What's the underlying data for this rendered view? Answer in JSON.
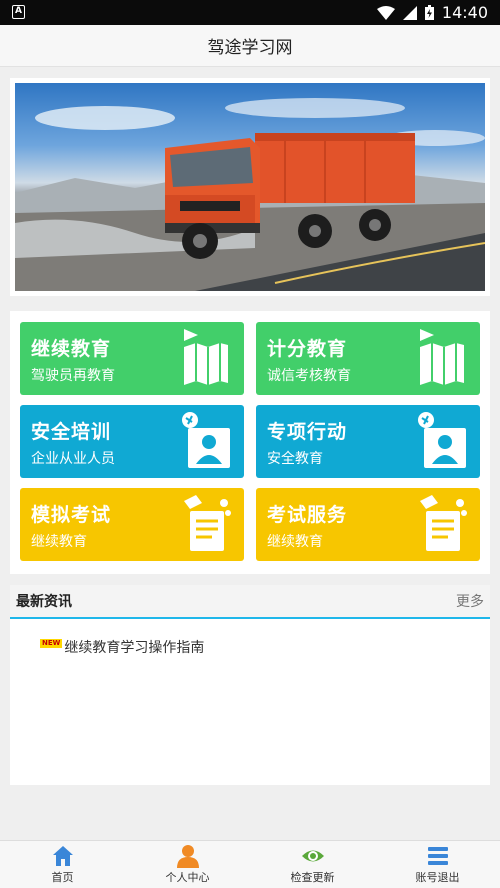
{
  "status_bar": {
    "time": "14:40"
  },
  "header": {
    "title": "驾途学习网"
  },
  "tiles": [
    {
      "title": "继续教育",
      "subtitle": "驾驶员再教育",
      "color": "#42cf6a",
      "icon": "map-icon"
    },
    {
      "title": "计分教育",
      "subtitle": "诚信考核教育",
      "color": "#42cf6a",
      "icon": "map-icon"
    },
    {
      "title": "安全培训",
      "subtitle": "企业从业人员",
      "color": "#10a9d3",
      "icon": "user-card-icon"
    },
    {
      "title": "专项行动",
      "subtitle": "安全教育",
      "color": "#10a9d3",
      "icon": "user-card-icon"
    },
    {
      "title": "模拟考试",
      "subtitle": "继续教育",
      "color": "#f7c600",
      "icon": "document-icon"
    },
    {
      "title": "考试服务",
      "subtitle": "继续教育",
      "color": "#f7c600",
      "icon": "document-icon"
    }
  ],
  "news": {
    "title": "最新资讯",
    "more": "更多",
    "items": [
      {
        "badge": "NEW",
        "text": "继续教育学习操作指南"
      }
    ]
  },
  "bottom_nav": [
    {
      "label": "首页",
      "icon": "home-icon",
      "color": "#3a86d8"
    },
    {
      "label": "个人中心",
      "icon": "person-icon",
      "color": "#f08a24"
    },
    {
      "label": "检查更新",
      "icon": "eye-icon",
      "color": "#5aa83a"
    },
    {
      "label": "账号退出",
      "icon": "menu-icon",
      "color": "#3a86d8"
    }
  ]
}
